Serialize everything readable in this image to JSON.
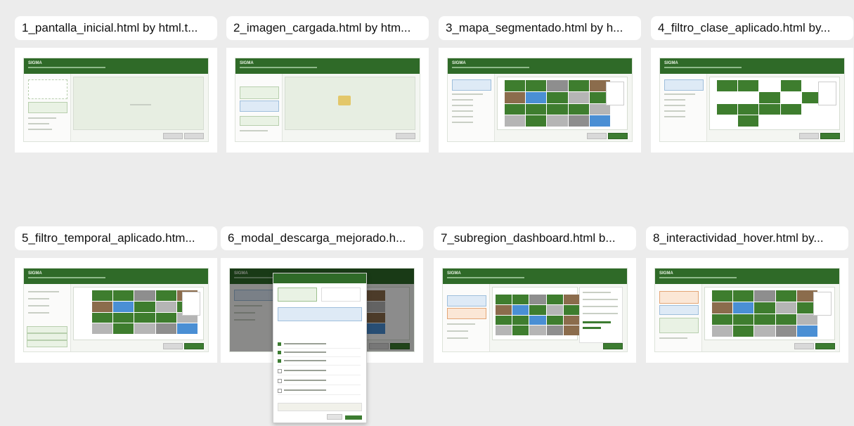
{
  "cards": [
    {
      "title": "1_pantalla_inicial.html by html.t..."
    },
    {
      "title": "2_imagen_cargada.html by htm..."
    },
    {
      "title": "3_mapa_segmentado.html by h..."
    },
    {
      "title": "4_filtro_clase_aplicado.html by..."
    },
    {
      "title": "5_filtro_temporal_aplicado.htm..."
    },
    {
      "title": "6_modal_descarga_mejorado.h..."
    },
    {
      "title": "7_subregion_dashboard.html b..."
    },
    {
      "title": "8_interactividad_hover.html by..."
    }
  ],
  "colors": {
    "background": "#ececec",
    "header_green": "#2f6a28",
    "forest": "#3e7d2e",
    "water": "#4a8fd4",
    "soil": "#8b6c4c",
    "urban": "#8e8e8e"
  }
}
